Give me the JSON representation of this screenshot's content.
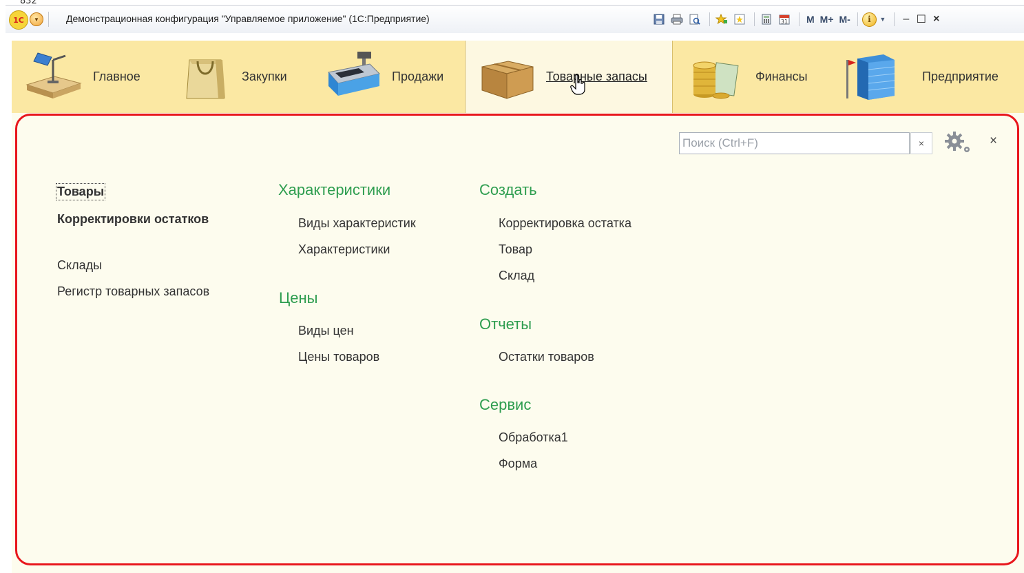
{
  "corner_label": "832",
  "window": {
    "title": "Демонстрационная конфигурация \"Управляемое приложение\"  (1С:Предприятие)",
    "logo_text": "1С",
    "toolbar": {
      "m": "M",
      "m_plus": "M+",
      "m_minus": "M-",
      "calendar_day": "31"
    },
    "icons": [
      "save-icon",
      "print-icon",
      "preview-icon",
      "favorites-add-icon",
      "favorites-icon",
      "calculator-icon",
      "calendar-icon",
      "info-icon"
    ]
  },
  "sections": [
    {
      "label": "Главное",
      "icon": "desk-lamp-icon"
    },
    {
      "label": "Закупки",
      "icon": "shopping-bag-icon"
    },
    {
      "label": "Продажи",
      "icon": "cash-register-icon"
    },
    {
      "label": "Товарные запасы",
      "icon": "box-icon",
      "active": true
    },
    {
      "label": "Финансы",
      "icon": "coins-icon"
    },
    {
      "label": "Предприятие",
      "icon": "building-icon"
    }
  ],
  "search": {
    "placeholder": "Поиск (Ctrl+F)",
    "clear": "×"
  },
  "close_symbol": "×",
  "column1": {
    "items": [
      "Товары",
      "Корректировки остатков",
      "Склады",
      "Регистр товарных запасов"
    ]
  },
  "column2": {
    "groups": [
      {
        "title": "Характеристики",
        "items": [
          "Виды характеристик",
          "Характеристики"
        ]
      },
      {
        "title": "Цены",
        "items": [
          "Виды цен",
          "Цены товаров"
        ]
      }
    ]
  },
  "column3": {
    "groups": [
      {
        "title": "Создать",
        "items": [
          "Корректировка остатка",
          "Товар",
          "Склад"
        ]
      },
      {
        "title": "Отчеты",
        "items": [
          "Остатки товаров"
        ]
      },
      {
        "title": "Сервис",
        "items": [
          "Обработка1",
          "Форма"
        ]
      }
    ]
  },
  "colors": {
    "accent_green": "#2e9d4f",
    "highlight_red": "#e8161c",
    "sections_bg": "#fbe8a3"
  }
}
